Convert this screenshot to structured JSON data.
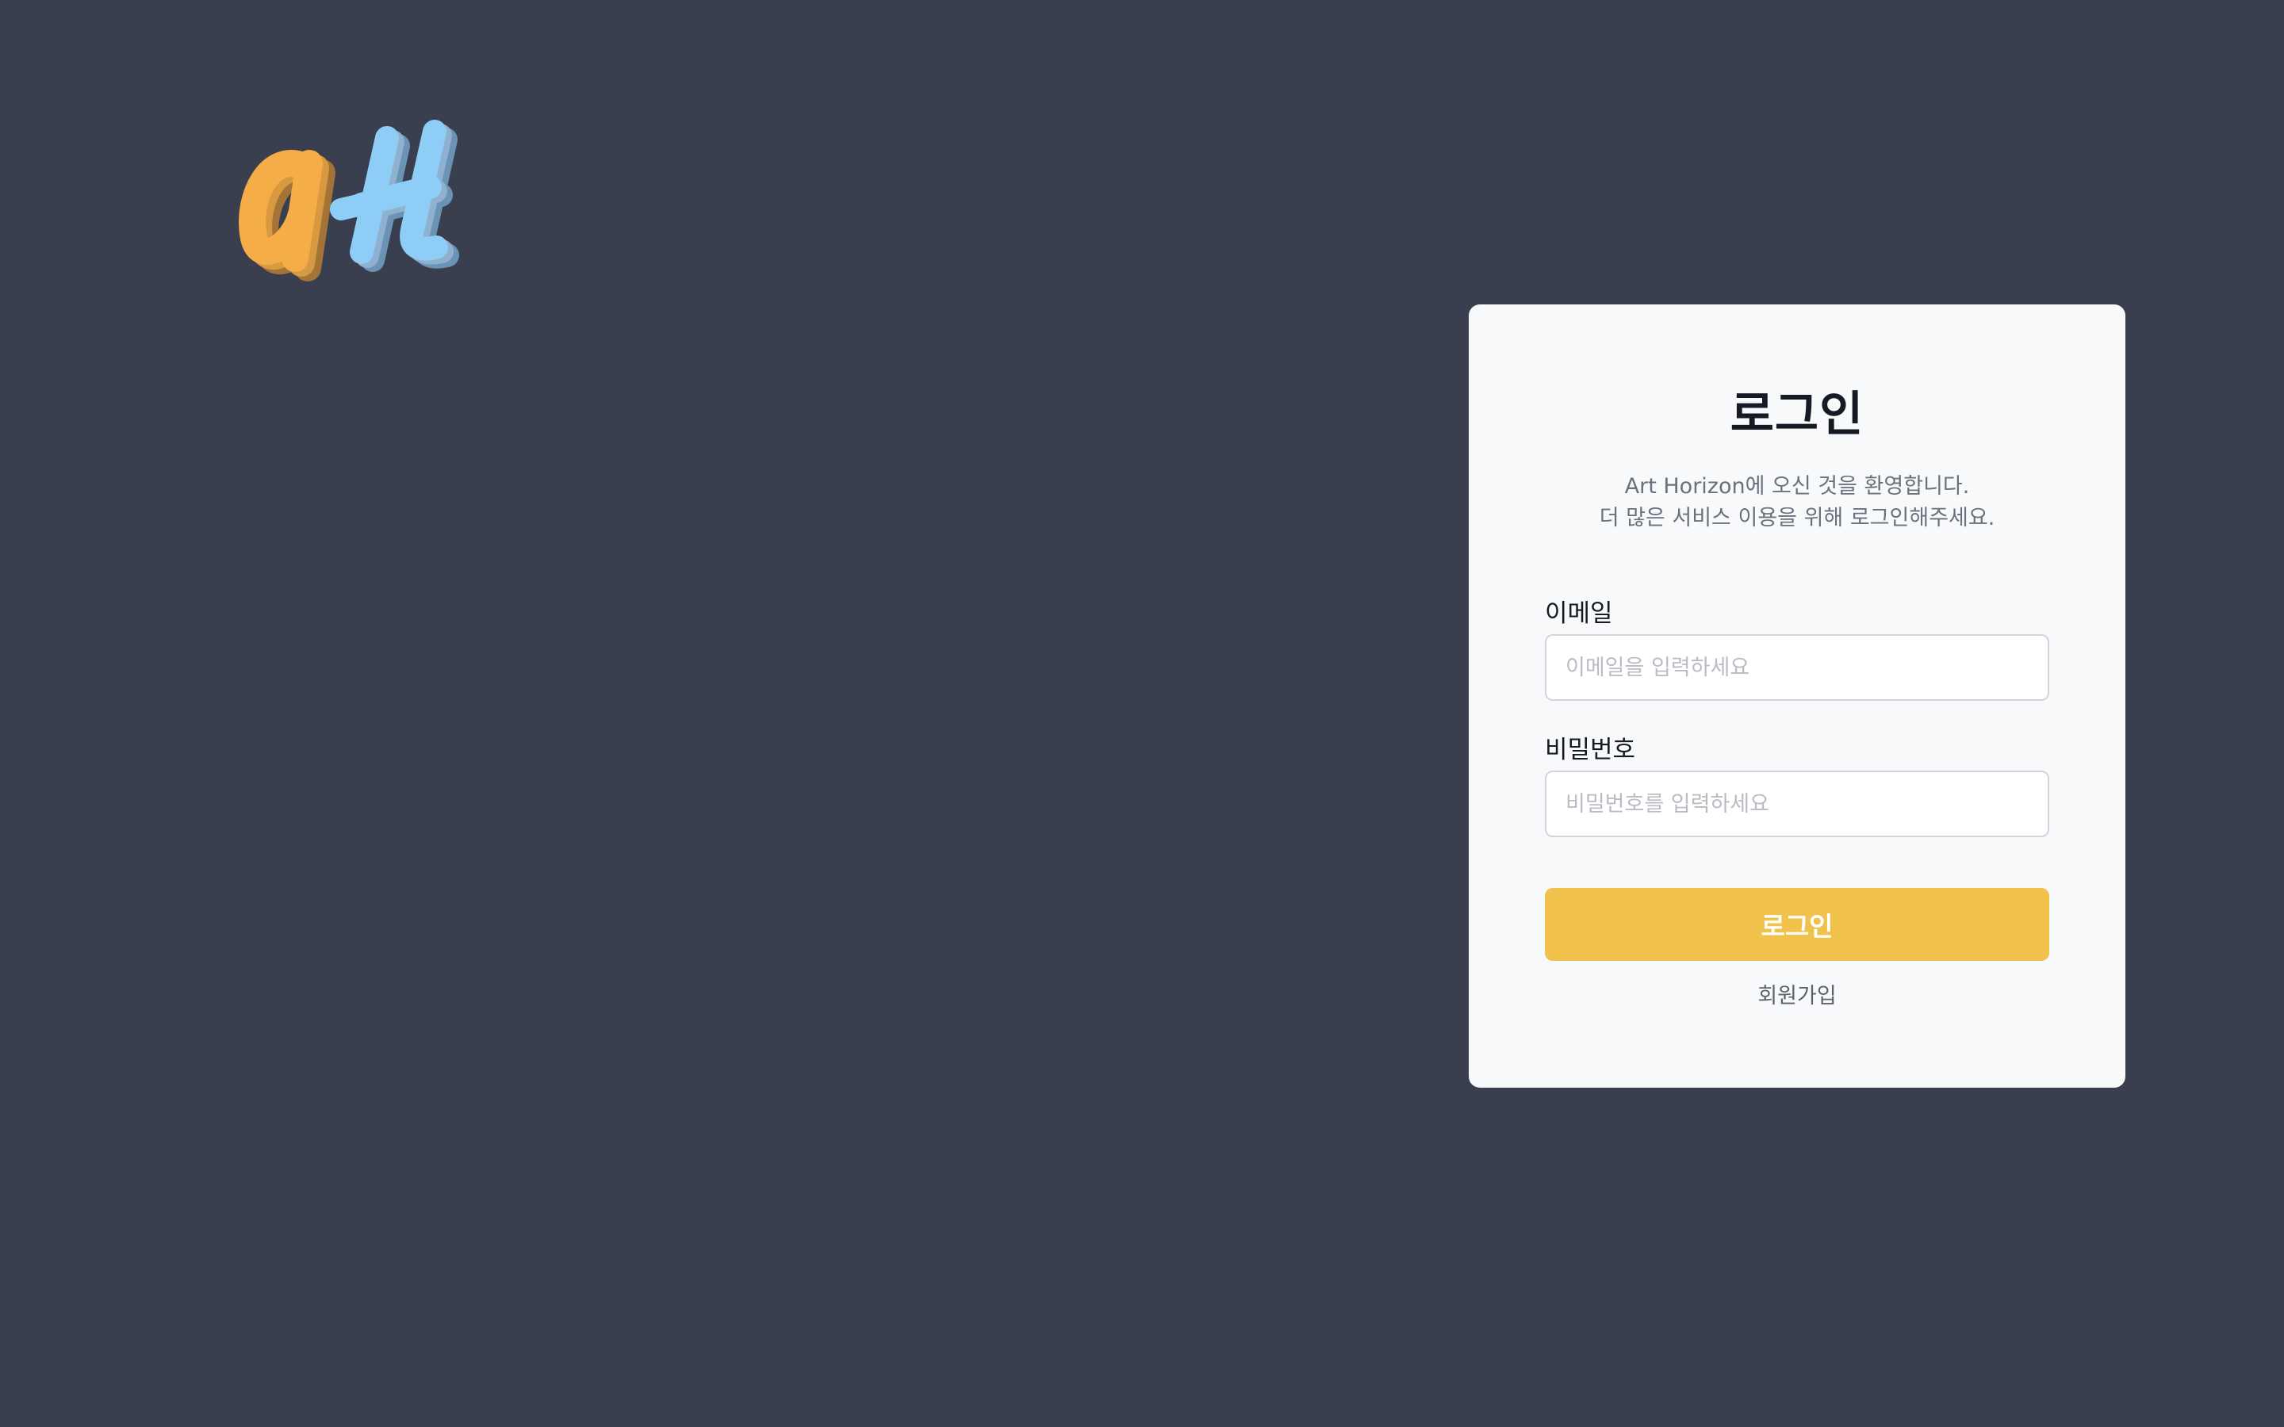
{
  "brand": {
    "logo_text": "aH",
    "logo_colors": {
      "a": "#f5ad47",
      "a_shadow": "#c98a36",
      "h": "#8ecdf5",
      "h_shadow": "#6b93b5"
    }
  },
  "login": {
    "title": "로그인",
    "subtitle_line1": "Art Horizon에 오신 것을 환영합니다.",
    "subtitle_line2": "더 많은 서비스 이용을 위해 로그인해주세요.",
    "email_label": "이메일",
    "email_placeholder": "이메일을 입력하세요",
    "email_value": "",
    "password_label": "비밀번호",
    "password_placeholder": "비밀번호를 입력하세요",
    "password_value": "",
    "submit_label": "로그인",
    "signup_label": "회원가입"
  },
  "colors": {
    "background": "#3a3f4f",
    "card": "#f8f9fb",
    "accent": "#f0c14b"
  }
}
